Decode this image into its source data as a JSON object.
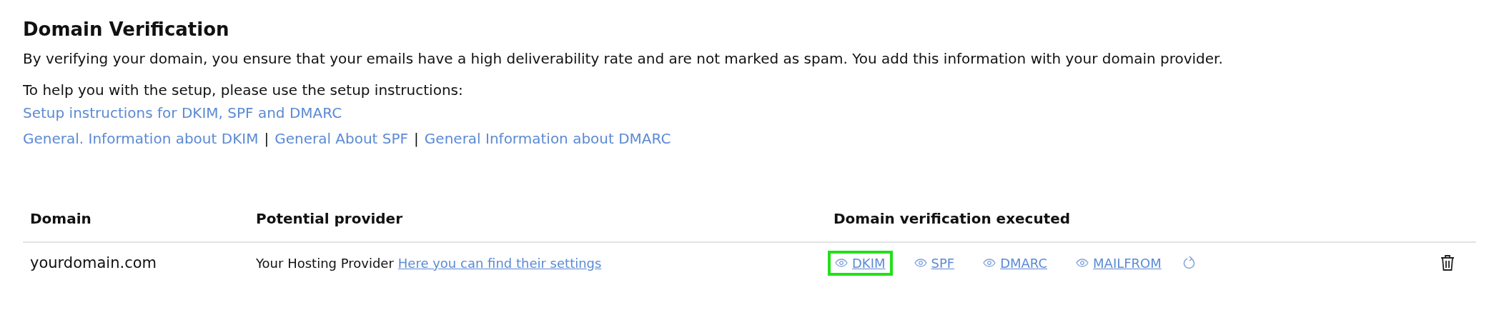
{
  "title": "Domain Verification",
  "description": "By verifying your domain, you ensure that your emails have a high deliverability rate and are not marked as spam. You add this information with your domain provider.",
  "help_text": "To help you with the setup, please use the setup instructions:",
  "setup_link": "Setup instructions for DKIM, SPF and DMARC",
  "info_links": [
    {
      "label": "General. Information about DKIM"
    },
    {
      "label": "General About SPF"
    },
    {
      "label": "General Information about DMARC"
    }
  ],
  "separator": "|",
  "table": {
    "columns": [
      "Domain",
      "Potential provider",
      "Domain verification executed"
    ],
    "rows": [
      {
        "domain": "yourdomain.com",
        "provider": "Your Hosting Provider",
        "provider_link": "Here you can find their settings",
        "checks": [
          {
            "label": "DKIM",
            "selected": true
          },
          {
            "label": "SPF",
            "selected": false
          },
          {
            "label": "DMARC",
            "selected": false
          },
          {
            "label": "MAILFROM",
            "selected": false
          }
        ]
      }
    ]
  }
}
